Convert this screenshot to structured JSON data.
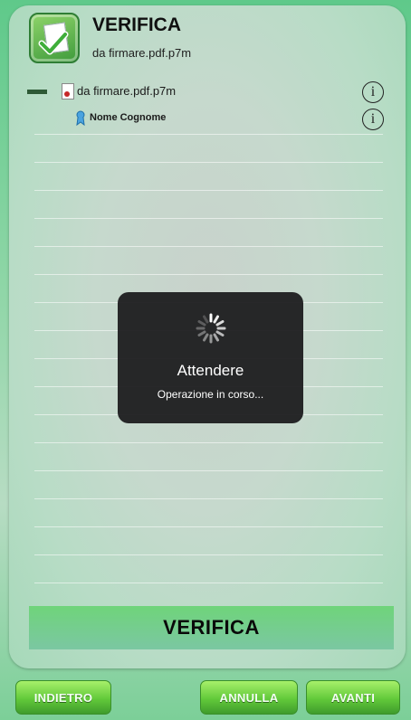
{
  "header": {
    "title": "VERIFICA",
    "subtitle": "da firmare.pdf.p7m",
    "icon": "verify-document-icon"
  },
  "tree": {
    "file": {
      "label": "da firmare.pdf.p7m",
      "icon": "pdf-file-icon",
      "info_icon": "info-icon"
    },
    "signer": {
      "label": "Nome Cognome",
      "icon": "certificate-icon",
      "info_icon": "info-icon"
    }
  },
  "action": {
    "label": "VERIFICA"
  },
  "overlay": {
    "title": "Attendere",
    "message": "Operazione in corso...",
    "icon": "spinner-icon"
  },
  "footer": {
    "back_label": "INDIETRO",
    "cancel_label": "ANNULLA",
    "next_label": "AVANTI"
  },
  "colors": {
    "accent_green": "#62c93a",
    "overlay_bg": "#1c1c1e"
  }
}
